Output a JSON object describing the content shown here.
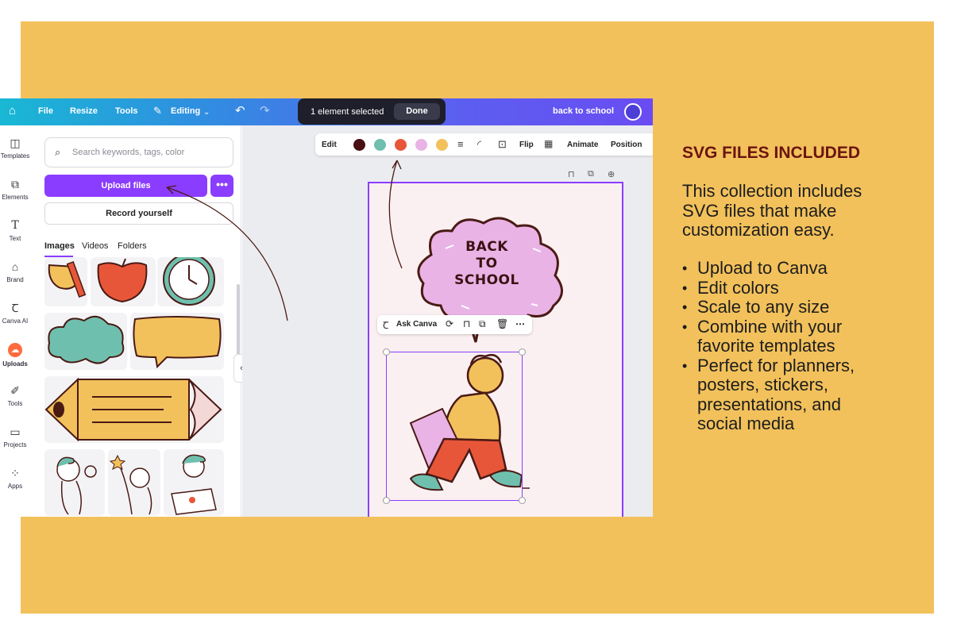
{
  "topbar": {
    "file_label": "File",
    "resize_label": "Resize",
    "tools_label": "Tools",
    "editing_label": "Editing",
    "doc_name": "back to school"
  },
  "selection_pill": {
    "text": "1 element selected",
    "done_label": "Done"
  },
  "rail": {
    "items": [
      {
        "label": "Templates",
        "icon": "templates-icon"
      },
      {
        "label": "Elements",
        "icon": "elements-icon"
      },
      {
        "label": "Text",
        "icon": "text-icon"
      },
      {
        "label": "Brand",
        "icon": "brand-icon"
      },
      {
        "label": "Canva AI",
        "icon": "canva-ai-icon"
      },
      {
        "label": "Uploads",
        "icon": "uploads-icon"
      },
      {
        "label": "Tools",
        "icon": "tools-icon"
      },
      {
        "label": "Projects",
        "icon": "projects-icon"
      },
      {
        "label": "Apps",
        "icon": "apps-icon"
      }
    ]
  },
  "panel": {
    "search_placeholder": "Search keywords, tags, color",
    "upload_label": "Upload files",
    "more_label": "•••",
    "record_label": "Record yourself",
    "tabs": [
      "Images",
      "Videos",
      "Folders"
    ]
  },
  "context_toolbar": {
    "edit_label": "Edit",
    "colors": [
      "#4a0f12",
      "#6fbfae",
      "#e8563a",
      "#e9b3e6",
      "#f2c15b"
    ],
    "flip_label": "Flip",
    "animate_label": "Animate",
    "position_label": "Position"
  },
  "design": {
    "bubble_lines": [
      "BACK",
      "TO",
      "SCHOOL"
    ],
    "ask_canva_label": "Ask Canva"
  },
  "promo": {
    "title": "SVG FILES INCLUDED",
    "intro": "This collection includes SVG files that make customization easy.",
    "bullets": [
      "Upload to Canva",
      "Edit colors",
      "Scale to any size",
      "Combine with your favorite templates",
      "Perfect for planners, posters, stickers, presentations, and social media"
    ]
  },
  "colors": {
    "background": "#f2c15b",
    "accent": "#8b3dff",
    "title": "#6b1410"
  }
}
